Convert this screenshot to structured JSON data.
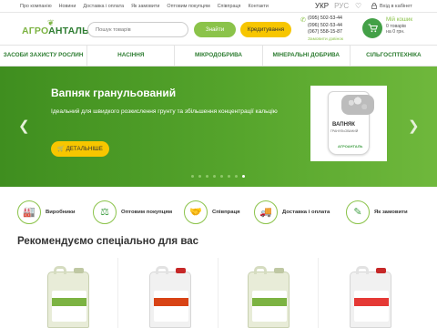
{
  "topbar": {
    "nav": [
      "Про компанію",
      "Новини",
      "Доставка і оплата",
      "Як замовити",
      "Оптовим покупцям",
      "Співпраця",
      "Контакти"
    ],
    "lang_active": "УКР",
    "lang_other": "РУС",
    "login": "Вхід в кабінет"
  },
  "header": {
    "logo_part1": "АГРО",
    "logo_part2": "АНТАЛЬ",
    "search_placeholder": "Пошук товарів",
    "find_button": "Знайти",
    "credit_button": "Кредитування",
    "phones": [
      "(095) 502-53-44",
      "(096) 502-53-44",
      "(067) 558-15-87"
    ],
    "callback": "Замовити дзвінок",
    "cart_title": "Мій кошик",
    "cart_count": "0 товарів",
    "cart_sum": "на 0 грн."
  },
  "categories": [
    "ЗАСОБИ ЗАХИСТУ РОСЛИН",
    "НАСІННЯ",
    "МІКРОДОБРИВА",
    "МІНЕРАЛЬНІ ДОБРИВА",
    "СІЛЬГОСПТЕХНІКА"
  ],
  "hero": {
    "title": "Вапняк гранульований",
    "description": "Ідеальний для швидкого розкислення грунту та збільшення концентрації кальцію",
    "button": "ДЕТАЛЬНІШЕ",
    "bag_label": "ВАПНЯК",
    "bag_sublabel": "ГРАНУЛЬОВАНИЙ",
    "bag_brand": "АГРОАНТАЛЬ",
    "slides_total": 8,
    "active_slide": 8
  },
  "features": [
    {
      "label": "Виробники",
      "icon": "factory-icon"
    },
    {
      "label": "Оптовим покупцям",
      "icon": "wholesale-icon"
    },
    {
      "label": "Співпраця",
      "icon": "handshake-icon"
    },
    {
      "label": "Доставка і оплата",
      "icon": "truck-icon"
    },
    {
      "label": "Як замовити",
      "icon": "order-icon"
    }
  ],
  "recommend_title": "Рекомендуємо спеціально для вас",
  "colors": {
    "brand_green": "#43a047",
    "light_green": "#8bc34a",
    "yellow": "#f7c600",
    "hero_green": "#4f9a27"
  }
}
